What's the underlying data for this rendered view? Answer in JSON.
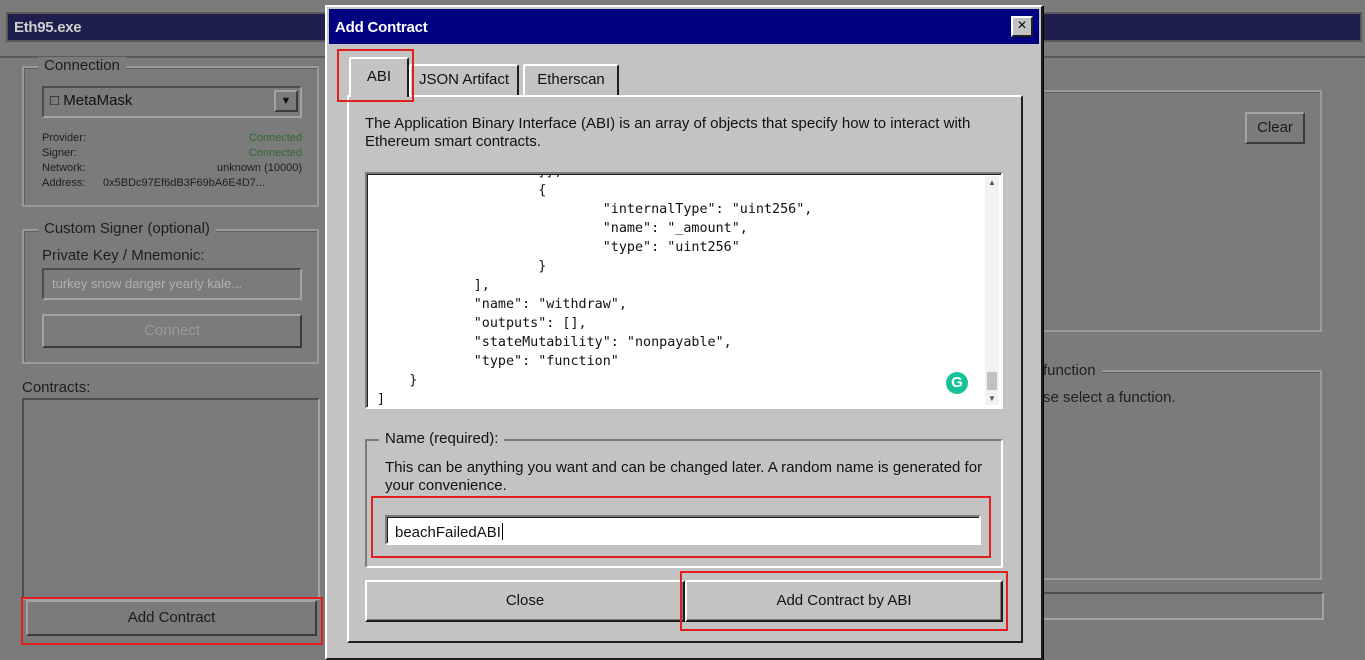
{
  "main_window": {
    "title": "Eth95.exe",
    "connection": {
      "legend": "Connection",
      "provider_select": "MetaMask",
      "provider_select_icon": "□",
      "info": [
        {
          "label": "Provider:",
          "value": "Connected",
          "status": "ok"
        },
        {
          "label": "Signer:",
          "value": "Connected",
          "status": "ok"
        },
        {
          "label": "Network:",
          "value": "unknown (10000)",
          "status": "plain"
        },
        {
          "label": "Address:",
          "value": "0x5BDc97Ef6dB3F69bA6E4D7...",
          "status": "plain"
        }
      ]
    },
    "custom_signer": {
      "legend": "Custom Signer (optional)",
      "label": "Private Key / Mnemonic:",
      "placeholder": "turkey snow danger yearly kale...",
      "connect_button": "Connect"
    },
    "contracts_label": "Contracts:",
    "add_contract_button": "Add Contract",
    "clear_button": "Clear",
    "function_legend_fragment": "function",
    "select_function_fragment": "se select a function."
  },
  "dialog": {
    "title": "Add Contract",
    "close_glyph": "×",
    "tabs": [
      "ABI",
      "JSON Artifact",
      "Etherscan"
    ],
    "active_tab": "ABI",
    "description": "The Application Binary Interface (ABI) is an array of objects that specify how to interact with Ethereum smart contracts.",
    "abi_text": "                    }},\n                    {\n                            \"internalType\": \"uint256\",\n                            \"name\": \"_amount\",\n                            \"type\": \"uint256\"\n                    }\n            ],\n            \"name\": \"withdraw\",\n            \"outputs\": [],\n            \"stateMutability\": \"nonpayable\",\n            \"type\": \"function\"\n    }\n]",
    "grammarly_icon": "G",
    "name_legend": "Name (required):",
    "name_help": "This can be anything you want and can be changed later. A random name is generated for your convenience.",
    "name_value": "beachFailedABI",
    "close_button": "Close",
    "add_button": "Add Contract by ABI"
  }
}
